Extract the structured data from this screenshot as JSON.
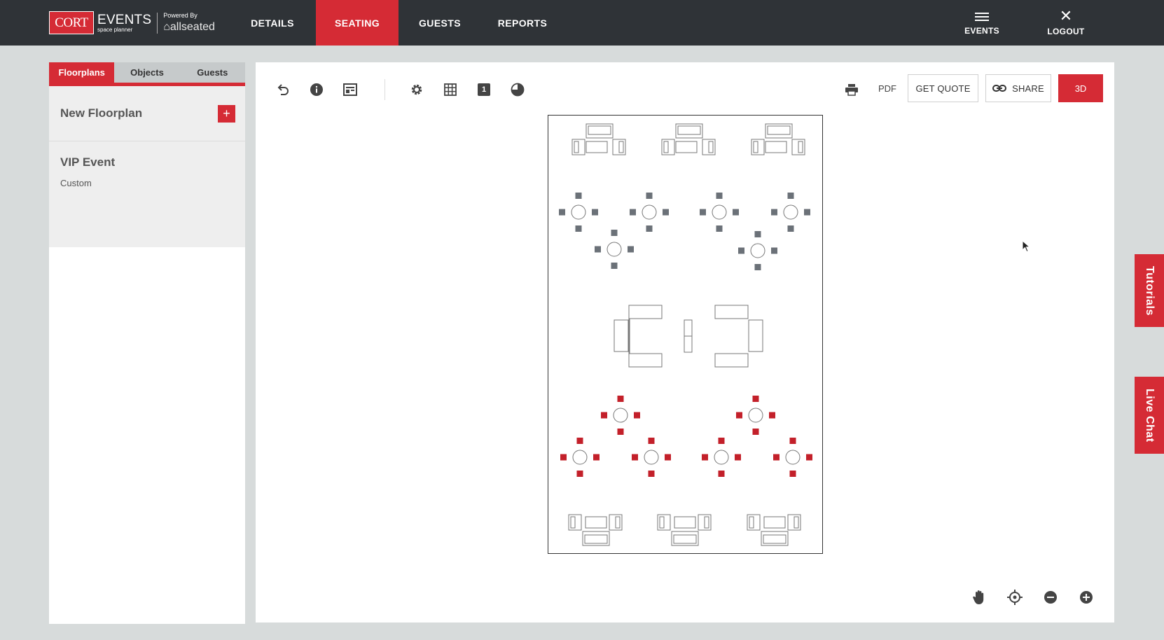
{
  "logo": {
    "brand": "CORT",
    "events": "EVENTS",
    "tagline": "space planner",
    "powered_by": "Powered By",
    "partner": "allseated"
  },
  "nav": {
    "items": [
      {
        "label": "DETAILS",
        "active": false
      },
      {
        "label": "SEATING",
        "active": true
      },
      {
        "label": "GUESTS",
        "active": false
      },
      {
        "label": "REPORTS",
        "active": false
      }
    ],
    "events_label": "EVENTS",
    "logout_label": "LOGOUT"
  },
  "sidebar": {
    "tabs": [
      {
        "label": "Floorplans",
        "active": true
      },
      {
        "label": "Objects",
        "active": false
      },
      {
        "label": "Guests",
        "active": false
      }
    ],
    "new_floorplan_label": "New Floorplan",
    "add_icon": "+",
    "floorplans": [
      {
        "name": "VIP Event",
        "type": "Custom"
      }
    ]
  },
  "toolbar": {
    "icons": [
      "undo-icon",
      "info-icon",
      "layout-icon",
      "settings-icon",
      "grid-icon",
      "number-badge-icon",
      "pie-icon"
    ],
    "number_badge": "1",
    "pdf_label": "PDF",
    "get_quote_label": "GET QUOTE",
    "share_label": "SHARE",
    "three_d_label": "3D"
  },
  "bottom_tools": [
    "pan-hand-icon",
    "center-target-icon",
    "zoom-out-icon",
    "zoom-in-icon"
  ],
  "side_tabs": {
    "tutorials": "Tutorials",
    "live_chat": "Live Chat"
  },
  "colors": {
    "accent": "#d52b35",
    "topbar": "#2f3337",
    "chair_gray": "#6b7178",
    "chair_red": "#c3202a"
  }
}
